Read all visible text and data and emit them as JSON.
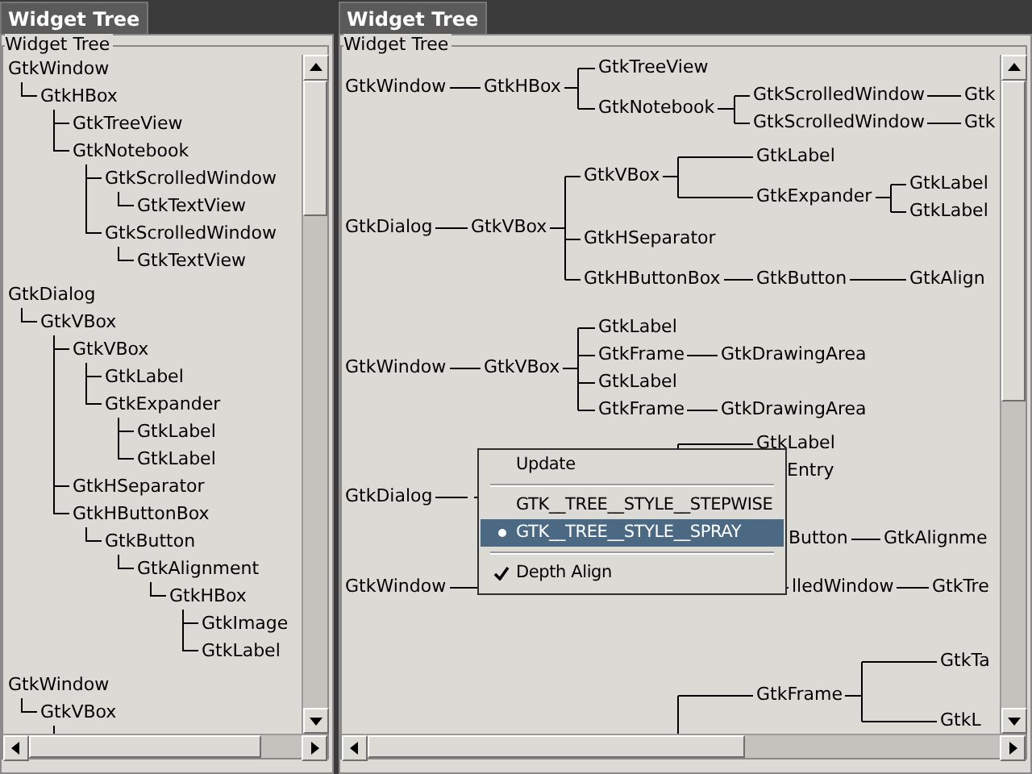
{
  "panes": [
    {
      "kind": "outline",
      "tab": "Widget Tree",
      "frame_label": "Widget Tree",
      "trees": [
        {
          "label": "GtkWindow",
          "children": [
            {
              "label": "GtkHBox",
              "children": [
                {
                  "label": "GtkTreeView"
                },
                {
                  "label": "GtkNotebook",
                  "children": [
                    {
                      "label": "GtkScrolledWindow",
                      "children": [
                        {
                          "label": "GtkTextView"
                        }
                      ]
                    },
                    {
                      "label": "GtkScrolledWindow",
                      "children": [
                        {
                          "label": "GtkTextView"
                        }
                      ]
                    }
                  ]
                }
              ]
            }
          ]
        },
        {
          "label": "GtkDialog",
          "children": [
            {
              "label": "GtkVBox",
              "children": [
                {
                  "label": "GtkVBox",
                  "children": [
                    {
                      "label": "GtkLabel"
                    },
                    {
                      "label": "GtkExpander",
                      "children": [
                        {
                          "label": "GtkLabel"
                        },
                        {
                          "label": "GtkLabel"
                        }
                      ]
                    }
                  ]
                },
                {
                  "label": "GtkHSeparator"
                },
                {
                  "label": "GtkHButtonBox",
                  "children": [
                    {
                      "label": "GtkButton",
                      "children": [
                        {
                          "label": "GtkAlignment",
                          "children": [
                            {
                              "label": "GtkHBox",
                              "children": [
                                {
                                  "label": "GtkImage"
                                },
                                {
                                  "label": "GtkLabel"
                                }
                              ]
                            }
                          ]
                        }
                      ]
                    }
                  ]
                }
              ]
            }
          ]
        },
        {
          "label": "GtkWindow",
          "children": [
            {
              "label": "GtkVBox",
              "truncated": true
            }
          ]
        }
      ]
    },
    {
      "kind": "spray",
      "tab": "Widget Tree",
      "frame_label": "Widget Tree",
      "trees": [
        {
          "label": "GtkWindow",
          "children": [
            {
              "label": "GtkHBox",
              "children": [
                {
                  "label": "GtkTreeView"
                },
                {
                  "label": "GtkNotebook",
                  "children": [
                    {
                      "label": "GtkScrolledWindow",
                      "children": [
                        {
                          "label": "Gtk"
                        }
                      ]
                    },
                    {
                      "label": "GtkScrolledWindow",
                      "children": [
                        {
                          "label": "Gtk"
                        }
                      ]
                    }
                  ]
                }
              ]
            }
          ]
        },
        {
          "label": "GtkDialog",
          "children": [
            {
              "label": "GtkVBox",
              "children": [
                {
                  "label": "GtkVBox",
                  "children": [
                    {
                      "label": "GtkLabel"
                    },
                    {
                      "label": "GtkExpander",
                      "children": [
                        {
                          "label": "GtkLabel"
                        },
                        {
                          "label": "GtkLabel"
                        }
                      ]
                    }
                  ]
                },
                {
                  "label": "GtkHSeparator"
                },
                {
                  "label": "GtkHButtonBox",
                  "children": [
                    {
                      "label": "GtkButton",
                      "children": [
                        {
                          "label": "GtkAlign"
                        }
                      ]
                    }
                  ]
                }
              ]
            }
          ]
        },
        {
          "label": "GtkWindow",
          "children": [
            {
              "label": "GtkVBox",
              "children": [
                {
                  "label": "GtkLabel"
                },
                {
                  "label": "GtkFrame",
                  "children": [
                    {
                      "label": "GtkDrawingArea"
                    }
                  ]
                },
                {
                  "label": "GtkLabel"
                },
                {
                  "label": "GtkFrame",
                  "children": [
                    {
                      "label": "GtkDrawingArea"
                    }
                  ]
                }
              ]
            }
          ]
        },
        {
          "label": "GtkDialog",
          "children": [
            {
              "children": [
                {
                  "children": [
                    {
                      "label": "GtkLabel"
                    },
                    {
                      "label": "Entry"
                    }
                  ]
                },
                {
                  "children": [
                    {
                      "label": "Button",
                      "children": [
                        {
                          "label": "GtkAlignme"
                        }
                      ]
                    }
                  ]
                }
              ]
            }
          ]
        },
        {
          "label": "GtkWindow",
          "children": [
            {
              "children": [
                {
                  "children": [
                    {
                      "label": "lledWindow",
                      "children": [
                        {
                          "label": "GtkTre"
                        }
                      ]
                    }
                  ]
                }
              ]
            }
          ]
        },
        {
          "children": [
            {
              "label": "GtkFrame",
              "children": [
                {
                  "label": "GtkTa"
                },
                {
                  "label": "GtkL"
                }
              ]
            }
          ]
        }
      ]
    }
  ],
  "context_menu": {
    "items": [
      {
        "kind": "action",
        "label": "Update",
        "highlighted": false
      },
      {
        "kind": "separator"
      },
      {
        "kind": "radio",
        "label": "GTK__TREE__STYLE__STEPWISE",
        "selected": false,
        "highlighted": false
      },
      {
        "kind": "radio",
        "label": "GTK__TREE__STYLE__SPRAY",
        "selected": true,
        "highlighted": true
      },
      {
        "kind": "separator"
      },
      {
        "kind": "check",
        "label": "Depth Align",
        "checked": true,
        "highlighted": false
      }
    ]
  }
}
